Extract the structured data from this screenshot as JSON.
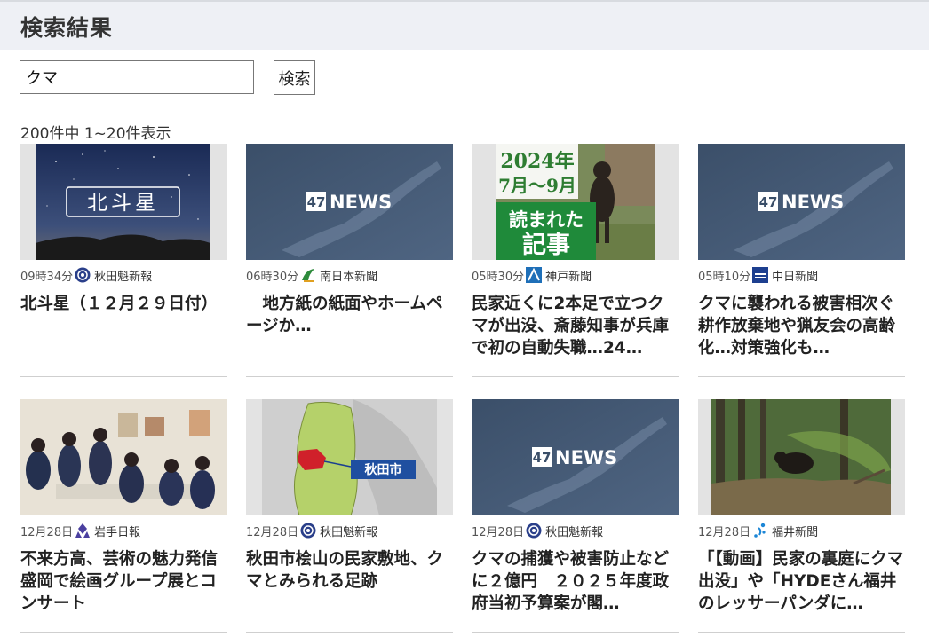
{
  "header": {
    "title": "検索結果"
  },
  "search": {
    "value": "クマ",
    "button_label": "検索"
  },
  "results_count": "200件中 1~20件表示",
  "cards": [
    {
      "time": "09時34分",
      "publisher": "秋田魁新報",
      "title": "北斗星（１２月２９日付）",
      "thumb_text": "北斗星"
    },
    {
      "time": "06時30分",
      "publisher": "南日本新聞",
      "title": "　地方紙の紙面やホームページか…",
      "thumb_text": "47NEWS"
    },
    {
      "time": "05時30分",
      "publisher": "神戸新聞",
      "title": "民家近くに2本足で立つクマが出没、斎藤知事が兵庫で初の自動失職…24…",
      "thumb_text": [
        "2024年",
        "7月～9月",
        "読まれた",
        "記事"
      ]
    },
    {
      "time": "05時10分",
      "publisher": "中日新聞",
      "title": "クマに襲われる被害相次ぐ　耕作放棄地や猟友会の高齢化…対策強化も…",
      "thumb_text": "47NEWS"
    },
    {
      "time": "12月28日",
      "publisher": "岩手日報",
      "title": "不来方高、芸術の魅力発信　盛岡で絵画グループ展とコンサート",
      "thumb_text": ""
    },
    {
      "time": "12月28日",
      "publisher": "秋田魁新報",
      "title": "秋田市桧山の民家敷地、クマとみられる足跡",
      "thumb_text": "秋田市"
    },
    {
      "time": "12月28日",
      "publisher": "秋田魁新報",
      "title": "クマの捕獲や被害防止などに２億円　２０２５年度政府当初予算案が閣…",
      "thumb_text": "47NEWS"
    },
    {
      "time": "12月28日",
      "publisher": "福井新聞",
      "title": "「【動画】民家の裏庭にクマ出没」や「HYDEさん福井のレッサーパンダに…",
      "thumb_text": ""
    }
  ],
  "colors": {
    "header_bg": "#eef0f5",
    "news47_bg": "#3a4e68",
    "akita_logo": "#2a3f8a",
    "minaminihon_logo": "#2e8b3c",
    "kobe_logo": "#1e6fb8",
    "chunichi_logo": "#1d3f8f",
    "iwate_logo": "#4a3f9f",
    "fukui_logo": "#1c86d6"
  },
  "icons": [
    "akita-sakigake-logo-icon",
    "minaminihon-logo-icon",
    "kobe-shimbun-logo-icon",
    "chunichi-logo-icon",
    "iwate-nippo-logo-icon",
    "fukui-shimbun-logo-icon"
  ]
}
